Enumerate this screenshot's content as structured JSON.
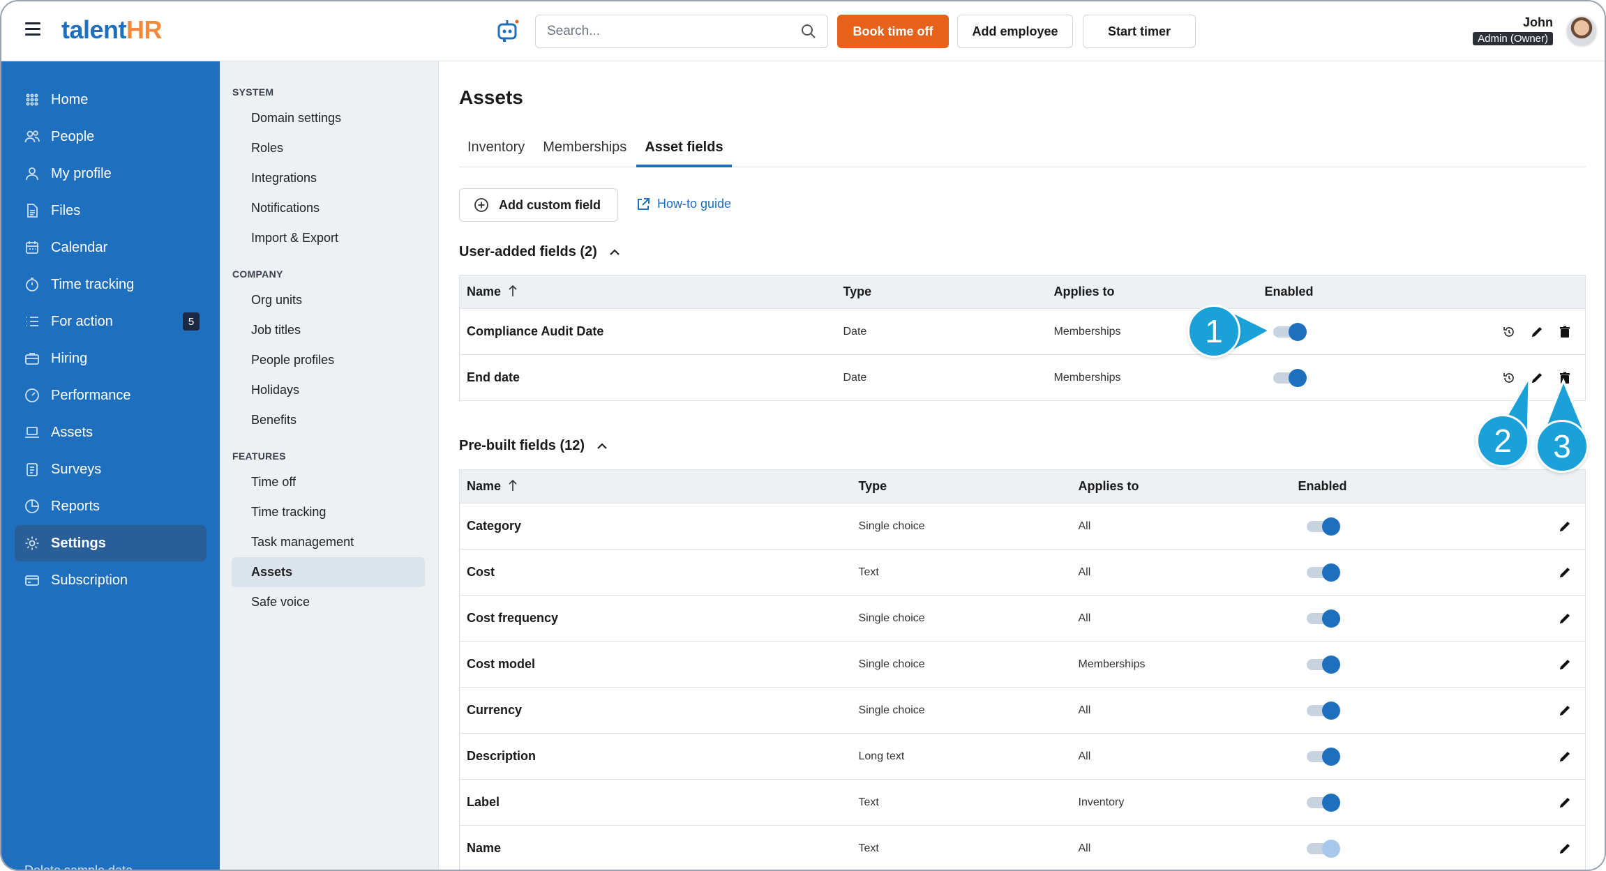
{
  "app": {
    "logo_main": "talent",
    "logo_accent": "HR"
  },
  "header": {
    "search_placeholder": "Search...",
    "book_time_off": "Book time off",
    "add_employee": "Add employee",
    "start_timer": "Start timer",
    "user_name": "John",
    "user_role": "Admin (Owner)"
  },
  "leftnav": {
    "items": [
      {
        "label": "Home",
        "icon": "grid-icon"
      },
      {
        "label": "People",
        "icon": "people-icon"
      },
      {
        "label": "My profile",
        "icon": "user-icon"
      },
      {
        "label": "Files",
        "icon": "file-icon"
      },
      {
        "label": "Calendar",
        "icon": "calendar-icon"
      },
      {
        "label": "Time tracking",
        "icon": "stopwatch-icon"
      },
      {
        "label": "For action",
        "icon": "list-icon",
        "badge": "5"
      },
      {
        "label": "Hiring",
        "icon": "briefcase-icon"
      },
      {
        "label": "Performance",
        "icon": "gauge-icon"
      },
      {
        "label": "Assets",
        "icon": "laptop-icon"
      },
      {
        "label": "Surveys",
        "icon": "clipboard-icon"
      },
      {
        "label": "Reports",
        "icon": "pie-chart-icon"
      },
      {
        "label": "Settings",
        "icon": "gear-icon",
        "active": true
      },
      {
        "label": "Subscription",
        "icon": "card-icon"
      }
    ],
    "bottom_text": "Delete sample data"
  },
  "subnav": {
    "system_heading": "SYSTEM",
    "system": [
      "Domain settings",
      "Roles",
      "Integrations",
      "Notifications",
      "Import & Export"
    ],
    "company_heading": "COMPANY",
    "company": [
      "Org units",
      "Job titles",
      "People profiles",
      "Holidays",
      "Benefits"
    ],
    "features_heading": "FEATURES",
    "features": [
      "Time off",
      "Time tracking",
      "Task management",
      "Assets",
      "Safe voice"
    ],
    "active": "Assets"
  },
  "main": {
    "title": "Assets",
    "tabs": [
      "Inventory",
      "Memberships",
      "Asset fields"
    ],
    "active_tab": "Asset fields",
    "add_custom_field": "Add custom field",
    "howto": "How-to guide",
    "user_section": "User-added fields (2)",
    "prebuilt_section": "Pre-built fields (12)",
    "columns": {
      "name": "Name",
      "type": "Type",
      "applies": "Applies to",
      "enabled": "Enabled"
    },
    "user_fields": [
      {
        "name": "Compliance Audit Date",
        "type": "Date",
        "applies": "Memberships",
        "enabled": true
      },
      {
        "name": "End date",
        "type": "Date",
        "applies": "Memberships",
        "enabled": true
      }
    ],
    "prebuilt_fields": [
      {
        "name": "Category",
        "type": "Single choice",
        "applies": "All",
        "enabled": true
      },
      {
        "name": "Cost",
        "type": "Text",
        "applies": "All",
        "enabled": true
      },
      {
        "name": "Cost frequency",
        "type": "Single choice",
        "applies": "All",
        "enabled": true
      },
      {
        "name": "Cost model",
        "type": "Single choice",
        "applies": "Memberships",
        "enabled": true
      },
      {
        "name": "Currency",
        "type": "Single choice",
        "applies": "All",
        "enabled": true
      },
      {
        "name": "Description",
        "type": "Long text",
        "applies": "All",
        "enabled": true
      },
      {
        "name": "Label",
        "type": "Text",
        "applies": "Inventory",
        "enabled": true
      },
      {
        "name": "Name",
        "type": "Text",
        "applies": "All",
        "enabled": true,
        "locked": true
      }
    ]
  },
  "callouts": [
    "1",
    "2",
    "3"
  ],
  "colors": {
    "brand": "#1f6fbf",
    "accent": "#e8611a",
    "callout": "#1aa1d8"
  }
}
